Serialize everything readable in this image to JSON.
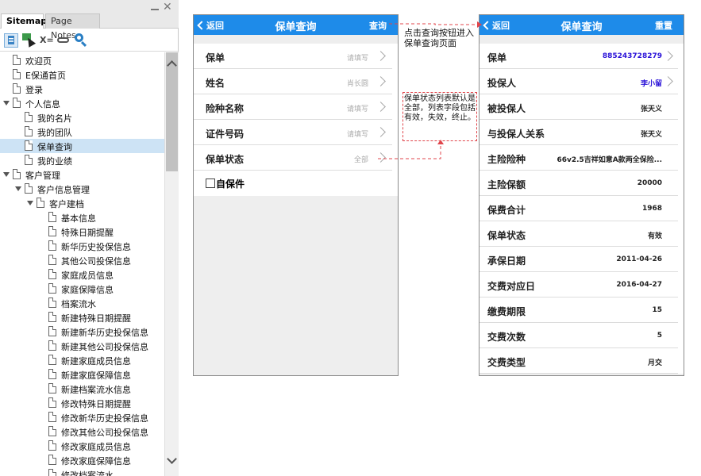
{
  "panel": {
    "tabs": [
      "Sitemap",
      "Page Notes"
    ],
    "toolbar_var_label": "X="
  },
  "tree": [
    {
      "label": "欢迎页",
      "level": 0,
      "has_children": false,
      "selected": false
    },
    {
      "label": "E保通首页",
      "level": 0,
      "has_children": false,
      "selected": false
    },
    {
      "label": "登录",
      "level": 0,
      "has_children": false,
      "selected": false
    },
    {
      "label": "个人信息",
      "level": 0,
      "has_children": true,
      "selected": false
    },
    {
      "label": "我的名片",
      "level": 1,
      "has_children": false,
      "selected": false
    },
    {
      "label": "我的团队",
      "level": 1,
      "has_children": false,
      "selected": false
    },
    {
      "label": "保单查询",
      "level": 1,
      "has_children": false,
      "selected": true
    },
    {
      "label": "我的业绩",
      "level": 1,
      "has_children": false,
      "selected": false
    },
    {
      "label": "客户管理",
      "level": 0,
      "has_children": true,
      "selected": false
    },
    {
      "label": "客户信息管理",
      "level": 1,
      "has_children": true,
      "selected": false
    },
    {
      "label": "客户建档",
      "level": 2,
      "has_children": true,
      "selected": false
    },
    {
      "label": "基本信息",
      "level": 3,
      "has_children": false,
      "selected": false
    },
    {
      "label": "特殊日期提醒",
      "level": 3,
      "has_children": false,
      "selected": false
    },
    {
      "label": "新华历史投保信息",
      "level": 3,
      "has_children": false,
      "selected": false
    },
    {
      "label": "其他公司投保信息",
      "level": 3,
      "has_children": false,
      "selected": false
    },
    {
      "label": "家庭成员信息",
      "level": 3,
      "has_children": false,
      "selected": false
    },
    {
      "label": "家庭保障信息",
      "level": 3,
      "has_children": false,
      "selected": false
    },
    {
      "label": "档案流水",
      "level": 3,
      "has_children": false,
      "selected": false
    },
    {
      "label": "新建特殊日期提醒",
      "level": 3,
      "has_children": false,
      "selected": false
    },
    {
      "label": "新建新华历史投保信息",
      "level": 3,
      "has_children": false,
      "selected": false
    },
    {
      "label": "新建其他公司投保信息",
      "level": 3,
      "has_children": false,
      "selected": false
    },
    {
      "label": "新建家庭成员信息",
      "level": 3,
      "has_children": false,
      "selected": false
    },
    {
      "label": "新建家庭保障信息",
      "level": 3,
      "has_children": false,
      "selected": false
    },
    {
      "label": "新建档案流水信息",
      "level": 3,
      "has_children": false,
      "selected": false
    },
    {
      "label": "修改特殊日期提醒",
      "level": 3,
      "has_children": false,
      "selected": false
    },
    {
      "label": "修改新华历史投保信息",
      "level": 3,
      "has_children": false,
      "selected": false
    },
    {
      "label": "修改其他公司投保信息",
      "level": 3,
      "has_children": false,
      "selected": false
    },
    {
      "label": "修改家庭成员信息",
      "level": 3,
      "has_children": false,
      "selected": false
    },
    {
      "label": "修改家庭保障信息",
      "level": 3,
      "has_children": false,
      "selected": false
    },
    {
      "label": "修改档案流水",
      "level": 3,
      "has_children": false,
      "selected": false
    }
  ],
  "screen1": {
    "back_label": "返回",
    "title": "保单查询",
    "action_label": "查询",
    "fields": [
      {
        "label": "保单",
        "value": "请填写"
      },
      {
        "label": "姓名",
        "value": "肖长圆"
      },
      {
        "label": "险种名称",
        "value": "请填写"
      },
      {
        "label": "证件号码",
        "value": "请填写"
      },
      {
        "label": "保单状态",
        "value": "全部"
      }
    ],
    "checkbox_label": "自保件"
  },
  "screen2": {
    "back_label": "返回",
    "title": "保单查询",
    "action_label": "重置",
    "fields": [
      {
        "label": "保单",
        "value": "885243728279",
        "link": true,
        "chevron": true
      },
      {
        "label": "投保人",
        "value": "李小留",
        "link": true,
        "chevron": true
      },
      {
        "label": "被投保人",
        "value": "张天义",
        "link": false,
        "chevron": false
      },
      {
        "label": "与投保人关系",
        "value": "张天义",
        "link": false,
        "chevron": false
      },
      {
        "label": "主险险种",
        "value": "66v2.5吉祥如意A款两全保险...",
        "link": false,
        "chevron": false
      },
      {
        "label": "主险保额",
        "value": "20000",
        "link": false,
        "chevron": false
      },
      {
        "label": "保费合计",
        "value": "1968",
        "link": false,
        "chevron": false
      },
      {
        "label": "保单状态",
        "value": "有效",
        "link": false,
        "chevron": false
      },
      {
        "label": "承保日期",
        "value": "2011-04-26",
        "link": false,
        "chevron": false
      },
      {
        "label": "交费对应日",
        "value": "2016-04-27",
        "link": false,
        "chevron": false
      },
      {
        "label": "缴费期限",
        "value": "15",
        "link": false,
        "chevron": false
      },
      {
        "label": "交费次数",
        "value": "5",
        "link": false,
        "chevron": false
      },
      {
        "label": "交费类型",
        "value": "月交",
        "link": false,
        "chevron": false
      }
    ]
  },
  "annotations": {
    "query_note": "点击查询按钮进入保单查询页面",
    "status_note": "保单状态列表默认是全部，列表字段包括有效，失效，终止。"
  },
  "colors": {
    "nav_bar": "#1e8be9",
    "link_value": "#2a12d8",
    "annotation_arrow": "#e0454b",
    "selected_row": "#cde3f5"
  }
}
